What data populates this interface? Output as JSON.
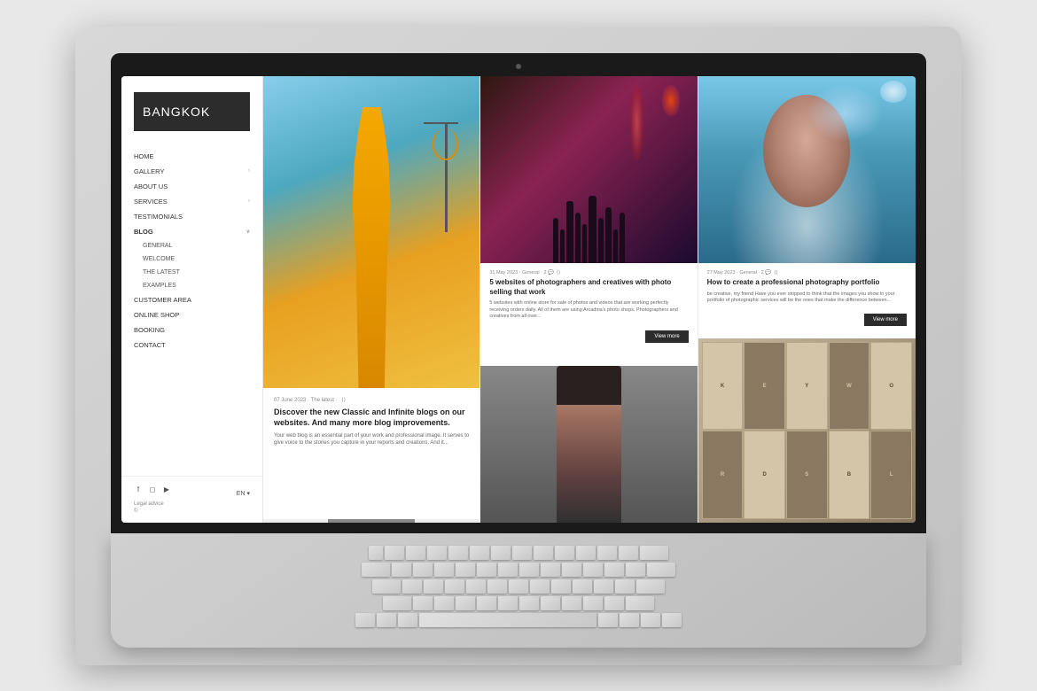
{
  "laptop": {
    "screen_bg": "#ffffff"
  },
  "website": {
    "logo": {
      "bold_text": "BANG",
      "light_text": "KOK"
    },
    "nav": {
      "items": [
        {
          "label": "HOME",
          "has_arrow": false
        },
        {
          "label": "GALLERY",
          "has_arrow": true
        },
        {
          "label": "ABOUT US",
          "has_arrow": false
        },
        {
          "label": "SERVICES",
          "has_arrow": true
        },
        {
          "label": "TESTIMONIALS",
          "has_arrow": false
        },
        {
          "label": "BLOG",
          "has_arrow": true,
          "is_blog": true
        },
        {
          "label": "GENERAL",
          "is_sub": true
        },
        {
          "label": "WELCOME",
          "is_sub": true
        },
        {
          "label": "THE LATEST",
          "is_sub": true
        },
        {
          "label": "EXAMPLES",
          "is_sub": true
        },
        {
          "label": "CUSTOMER AREA",
          "has_arrow": false
        },
        {
          "label": "ONLINE SHOP",
          "has_arrow": false
        },
        {
          "label": "BOOKING",
          "has_arrow": false
        },
        {
          "label": "CONTACT",
          "has_arrow": false
        }
      ]
    },
    "footer": {
      "legal": "Legal advice",
      "copyright": "©",
      "lang": "EN"
    },
    "featured_post": {
      "date": "07 June 2023 · The latest ·",
      "title": "Discover the new Classic and Infinite blogs on our websites. And many more blog improvements.",
      "excerpt": "Your web blog is an essential part of your work and professional image. It serves to give voice to the stories you capture in your reports and creations. And it..."
    },
    "middle_top_post": {
      "date": "31 May 2023 · General · 2",
      "title": "5 websites of photographers and creatives with photo selling that work",
      "excerpt": "5 websites with online store for sale of photos and videos that are working perfectly receiving orders daily. All of them are using Arcadina's photo shops. Photographers and creatives from all over...",
      "view_more": "View more"
    },
    "right_top_post": {
      "date": "27 May 2023 · General · 2",
      "title": "How to create a professional photography portfolio",
      "excerpt": "be creative, my friend Have you ever stopped to think that the images you show in your portfolio of photographic services will be the ones that make the difference between...",
      "view_more": "View more"
    },
    "keywords": [
      "K",
      "E",
      "Y",
      "W",
      "O",
      "R",
      "D",
      "S",
      "B",
      "L"
    ]
  }
}
